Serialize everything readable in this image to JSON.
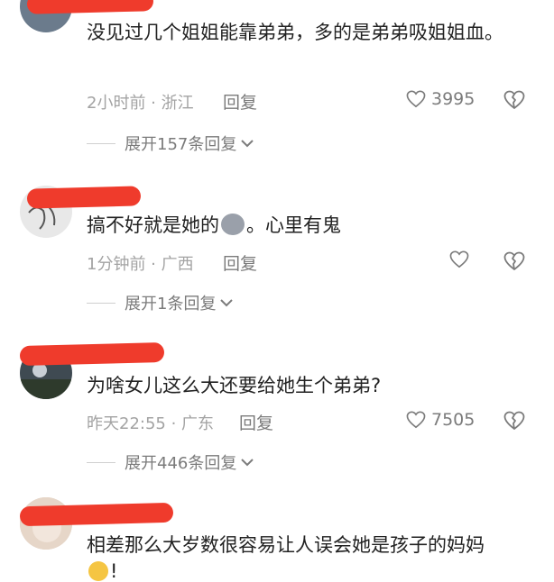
{
  "comments": [
    {
      "text": "没见过几个姐姐能靠弟弟，多的是弟弟吸姐姐血。",
      "time_location": "2小时前 · 浙江",
      "reply_label": "回复",
      "likes": "3995",
      "expand_label": "展开157条回复"
    },
    {
      "text_before": "搞不好就是她的",
      "text_after": "。心里有鬼",
      "time_location": "1分钟前 · 广西",
      "reply_label": "回复",
      "likes": "",
      "expand_label": "展开1条回复"
    },
    {
      "text": "为啥女儿这么大还要给她生个弟弟?",
      "time_location": "昨天22:55 · 广东",
      "reply_label": "回复",
      "likes": "7505",
      "expand_label": "展开446条回复"
    },
    {
      "text": "相差那么大岁数很容易让人误会她是孩子的妈妈",
      "text_cont": "!"
    }
  ],
  "icons": {
    "like": "heart-outline-icon",
    "dislike": "broken-heart-icon",
    "expand": "chevron-down-icon"
  },
  "colors": {
    "redaction": "#ef3b2c",
    "meta_text": "#a3a3a3",
    "secondary_text": "#7b7b7b"
  }
}
